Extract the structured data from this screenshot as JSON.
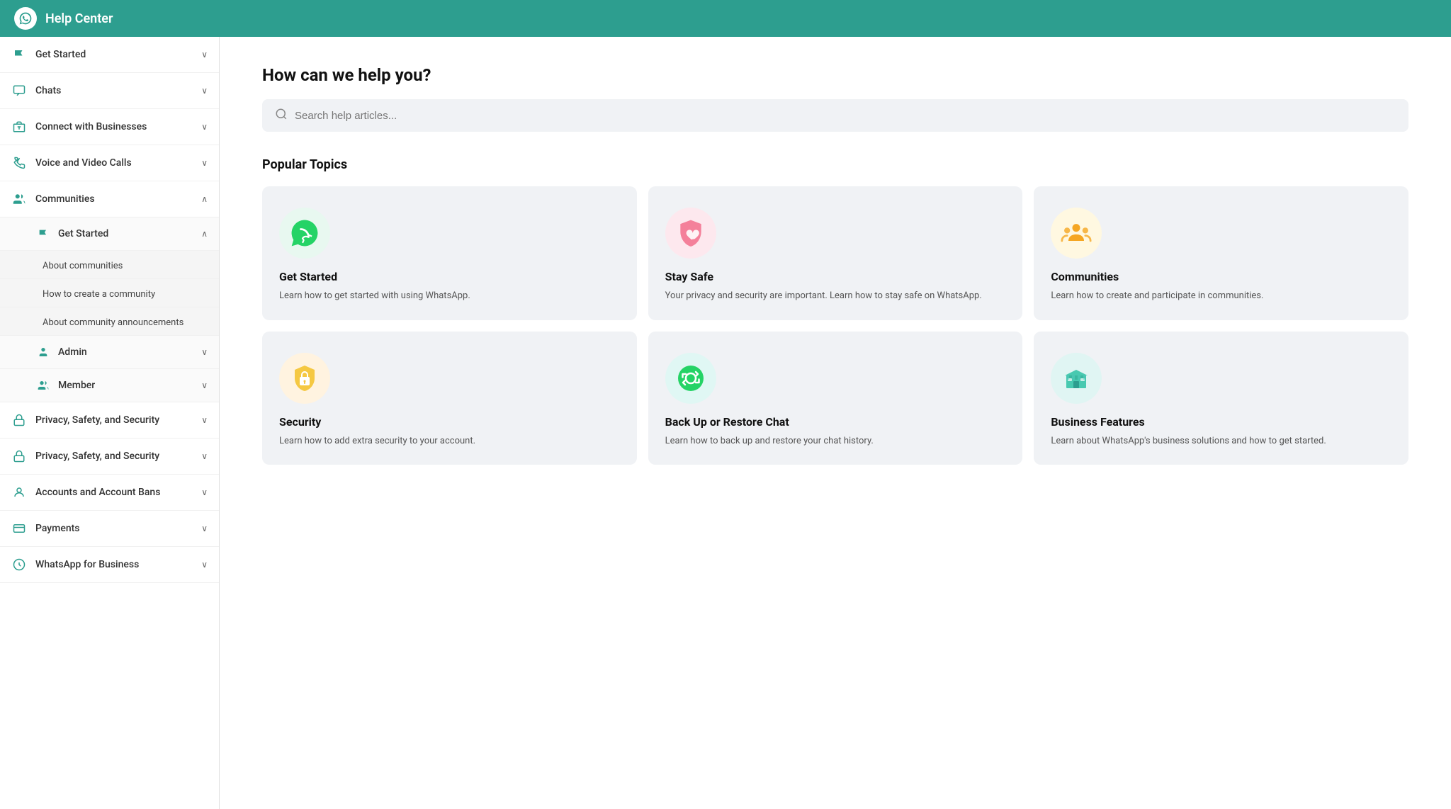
{
  "header": {
    "title": "Help Center",
    "logo_alt": "WhatsApp logo"
  },
  "sidebar": {
    "items": [
      {
        "id": "get-started",
        "label": "Get Started",
        "icon": "flag",
        "expanded": false
      },
      {
        "id": "chats",
        "label": "Chats",
        "icon": "chat",
        "expanded": false
      },
      {
        "id": "connect-businesses",
        "label": "Connect with Businesses",
        "icon": "store",
        "expanded": false
      },
      {
        "id": "voice-video",
        "label": "Voice and Video Calls",
        "icon": "phone",
        "expanded": false
      },
      {
        "id": "communities",
        "label": "Communities",
        "icon": "community",
        "expanded": true,
        "children": [
          {
            "id": "communities-get-started",
            "label": "Get Started",
            "icon": "flag",
            "expanded": true,
            "children": [
              {
                "id": "about-communities",
                "label": "About communities"
              },
              {
                "id": "how-create-community",
                "label": "How to create a community"
              },
              {
                "id": "community-announcements",
                "label": "About community announcements"
              }
            ]
          },
          {
            "id": "admin",
            "label": "Admin",
            "icon": "admin",
            "expanded": false
          },
          {
            "id": "member",
            "label": "Member",
            "icon": "member",
            "expanded": false
          }
        ]
      },
      {
        "id": "privacy-safety-1",
        "label": "Privacy, Safety, and Security",
        "icon": "lock",
        "expanded": false
      },
      {
        "id": "privacy-safety-2",
        "label": "Privacy, Safety, and Security",
        "icon": "lock2",
        "expanded": false
      },
      {
        "id": "accounts-bans",
        "label": "Accounts and Account Bans",
        "icon": "account",
        "expanded": false
      },
      {
        "id": "payments",
        "label": "Payments",
        "icon": "card",
        "expanded": false
      },
      {
        "id": "whatsapp-business",
        "label": "WhatsApp for Business",
        "icon": "business",
        "expanded": false
      }
    ]
  },
  "main": {
    "title": "How can we help you?",
    "search_placeholder": "Search help articles...",
    "popular_topics_label": "Popular Topics",
    "topics": [
      {
        "id": "get-started",
        "title": "Get Started",
        "description": "Learn how to get started with using WhatsApp.",
        "icon_type": "whatsapp",
        "icon_color": "green"
      },
      {
        "id": "stay-safe",
        "title": "Stay Safe",
        "description": "Your privacy and security are important. Learn how to stay safe on WhatsApp.",
        "icon_type": "shield-heart",
        "icon_color": "pink"
      },
      {
        "id": "communities",
        "title": "Communities",
        "description": "Learn how to create and participate in communities.",
        "icon_type": "group",
        "icon_color": "yellow"
      },
      {
        "id": "security",
        "title": "Security",
        "description": "Learn how to add extra security to your account.",
        "icon_type": "lock-bag",
        "icon_color": "yellow2"
      },
      {
        "id": "backup-restore",
        "title": "Back Up or Restore Chat",
        "description": "Learn how to back up and restore your chat history.",
        "icon_type": "restore",
        "icon_color": "teal"
      },
      {
        "id": "business-features",
        "title": "Business Features",
        "description": "Learn about WhatsApp's business solutions and how to get started.",
        "icon_type": "store-front",
        "icon_color": "teal2"
      }
    ]
  }
}
